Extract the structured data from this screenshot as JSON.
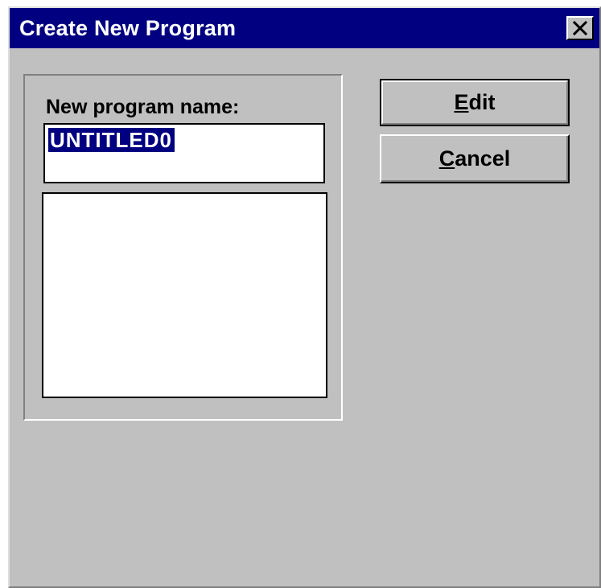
{
  "window": {
    "title": "Create New Program",
    "close_icon": "close-x-icon"
  },
  "form": {
    "name_label": "New program name:",
    "name_value": "UNTITLED0",
    "program_list_items": []
  },
  "buttons": {
    "edit": {
      "mnemonic": "E",
      "rest": "dit"
    },
    "cancel": {
      "mnemonic": "C",
      "rest": "ancel"
    }
  },
  "colors": {
    "titlebar": "#000080",
    "face": "#c0c0c0",
    "selection": "#000080"
  }
}
